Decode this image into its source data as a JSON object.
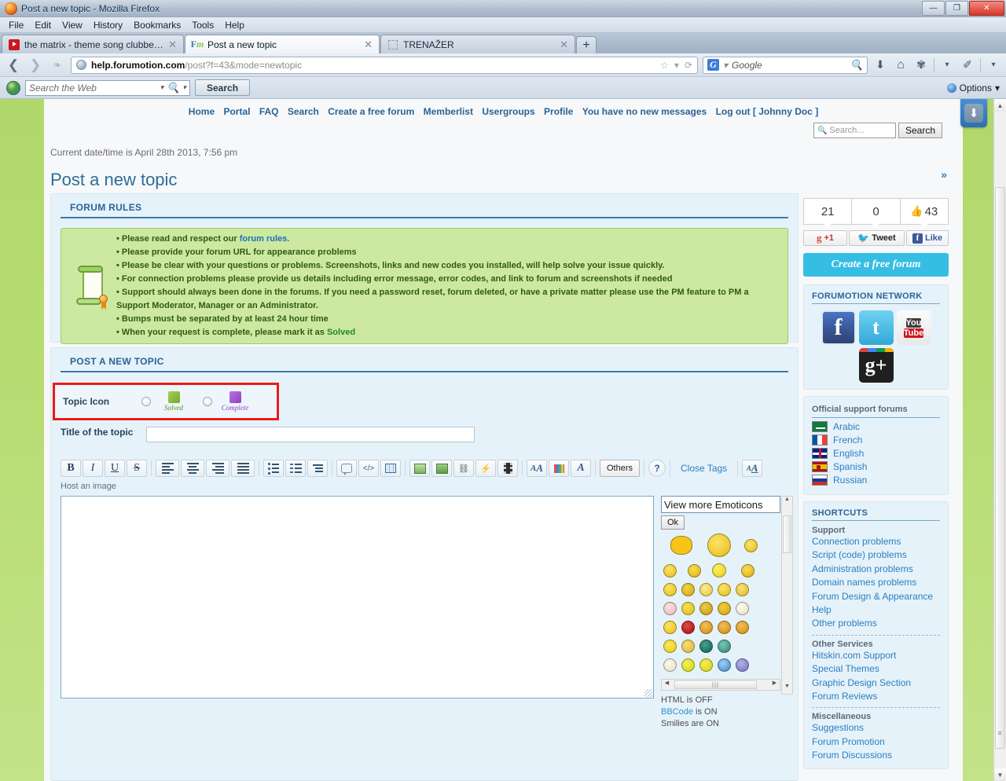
{
  "window": {
    "title": "Post a new topic - Mozilla Firefox",
    "minimize": "—",
    "maximize": "❐",
    "close": "✕"
  },
  "menubar": [
    {
      "label": "File"
    },
    {
      "label": "Edit"
    },
    {
      "label": "View"
    },
    {
      "label": "History"
    },
    {
      "label": "Bookmarks"
    },
    {
      "label": "Tools"
    },
    {
      "label": "Help"
    }
  ],
  "tabs": [
    {
      "label": "the matrix - theme song clubbed to d...",
      "close": "✕",
      "icon": "youtube-icon"
    },
    {
      "label": "Post a new topic",
      "close": "✕",
      "icon": "forumotion-icon"
    },
    {
      "label": "TRENAŽER",
      "close": "✕",
      "icon": "blank-favicon"
    }
  ],
  "newtab_label": "+",
  "navbar": {
    "back": "❮",
    "forward": "❯",
    "url_host": "help.forumotion.com",
    "url_path": "/post?f=43&mode=newtopic",
    "bookmark_icon": "☆",
    "dropdown_icon": "▾",
    "reload_icon": "⟳",
    "search_engine": "Google",
    "search_placeholder": "Google",
    "download_icon": "⬇",
    "home_icon": "⌂",
    "bookmarks_icon": "❧",
    "tools_icon": "✎"
  },
  "webbar": {
    "search_placeholder": "Search the Web",
    "search_button": "Search",
    "options_label": "Options",
    "options_caret": "▾"
  },
  "forum_nav": [
    "Home",
    "Portal",
    "FAQ",
    "Search",
    "Create a free forum",
    "Memberlist",
    "Usergroups",
    "Profile",
    "You have no new messages",
    "Log out [ Johnny Doc ]"
  ],
  "forum_search": {
    "placeholder": "Search...",
    "button": "Search"
  },
  "datetime": "Current date/time is April 28th 2013, 7:56 pm",
  "page_title": "Post a new topic",
  "forum_rules": {
    "heading": "FORUM RULES",
    "items": [
      {
        "pre": "Please read and respect our ",
        "link": "forum rules.",
        "post": ""
      },
      {
        "pre": "Please provide your forum URL for appearance problems",
        "link": "",
        "post": ""
      },
      {
        "pre": "Please be clear with your questions or problems. Screenshots, links and new codes you installed, will help solve your issue quickly.",
        "link": "",
        "post": ""
      },
      {
        "pre": "For connection problems please provide us details including error message, error codes, and link to forum and screenshots if needed",
        "link": "",
        "post": ""
      },
      {
        "pre": "Support should always been done in the forums. If you need a password reset, forum deleted, or have a private matter please use the PM feature to PM a Support Moderator, Manager or an Administrator.",
        "link": "",
        "post": ""
      },
      {
        "pre": "Bumps must be separated by at least 24 hour time",
        "link": "",
        "post": ""
      },
      {
        "pre": "When your request is complete, please mark it as ",
        "link": "",
        "post": "Solved"
      }
    ]
  },
  "post_form": {
    "heading": "POST A NEW TOPIC",
    "topic_icon_label": "Topic Icon",
    "topic_icons": [
      {
        "caption": "Solved",
        "color": "#76a92e"
      },
      {
        "caption": "Complete",
        "color": "#8e3fc4"
      }
    ],
    "title_label": "Title of the topic",
    "title_value": "",
    "host_image_label": "Host an image",
    "message_value": ""
  },
  "toolbar": {
    "bold": "B",
    "italic": "I",
    "underline": "U",
    "strike": "S",
    "others_label": "Others",
    "close_tags_label": "Close Tags",
    "help_icon": "?",
    "font_color_icon": "A",
    "font_size_icon": "A",
    "font_face_icon": "A"
  },
  "emoticons": {
    "more_label": "View more Emoticons",
    "ok_label": "Ok",
    "scroll_up": "▲",
    "scroll_down": "▼",
    "scroll_left": "◀",
    "scroll_right": "▶",
    "status": {
      "html": "HTML is OFF",
      "bbcode_name": "BBCode",
      "bbcode_state": " is ON",
      "smilies": "Smilies are ON"
    },
    "rows": [
      [
        {
          "name": "chef-smiley",
          "color": "#f5c518",
          "size": 26
        },
        {
          "name": "goofy-smiley",
          "color": "#f2cf2f",
          "size": 32
        },
        {
          "name": "grin-smiley",
          "color": "#f7d62e",
          "size": 18
        }
      ],
      [
        {
          "name": "smile-smiley",
          "color": "#f7d62e",
          "size": 18
        },
        {
          "name": "confused-smiley",
          "color": "#f2cf2f",
          "size": 18
        },
        {
          "name": "jumping-smiley",
          "color": "#f7e02e",
          "size": 20
        },
        {
          "name": "surprised-smiley",
          "color": "#f2cf2f",
          "size": 18
        }
      ],
      [
        {
          "name": "neutral-smiley",
          "color": "#f7d62e",
          "size": 18
        },
        {
          "name": "cool-smiley",
          "color": "#e8c728",
          "size": 18
        },
        {
          "name": "laugh-smiley",
          "color": "#f5de55",
          "size": 18
        },
        {
          "name": "wink-smiley",
          "color": "#f7d62e",
          "size": 18
        },
        {
          "name": "happy-smiley",
          "color": "#f3d84a",
          "size": 18
        }
      ],
      [
        {
          "name": "blush-smiley",
          "color": "#f2c7c7",
          "size": 18
        },
        {
          "name": "sick-smiley",
          "color": "#f0d330",
          "size": 18
        },
        {
          "name": "devil-smiley",
          "color": "#e0b51f",
          "size": 18
        },
        {
          "name": "angry-smiley",
          "color": "#e8c21c",
          "size": 18
        },
        {
          "name": "dizzy-smiley",
          "color": "#f7f1e0",
          "size": 18
        }
      ],
      [
        {
          "name": "wink2-smiley",
          "color": "#f7d62e",
          "size": 18
        },
        {
          "name": "red-ball-smiley",
          "color": "#cc1111",
          "size": 18
        },
        {
          "name": "exclamation-smiley",
          "color": "#e8a81c",
          "size": 18
        },
        {
          "name": "question-smiley",
          "color": "#e8a81c",
          "size": 18
        },
        {
          "name": "idea-smiley",
          "color": "#e8a81c",
          "size": 18
        }
      ],
      [
        {
          "name": "plain-smiley",
          "color": "#f2d41e",
          "size": 18
        },
        {
          "name": "glasses-smiley",
          "color": "#f0cf4a",
          "size": 18
        },
        {
          "name": "ninja-smiley",
          "color": "#1d6e63",
          "size": 18
        },
        {
          "name": "mask-smiley",
          "color": "#3e9a86",
          "size": 18
        }
      ],
      [
        {
          "name": "geek-smiley",
          "color": "#f5f0e0",
          "size": 18
        },
        {
          "name": "bigsmile-smiley",
          "color": "#e8e220",
          "size": 18
        },
        {
          "name": "shock-smiley",
          "color": "#e8e220",
          "size": 18
        },
        {
          "name": "blue-smiley",
          "color": "#5fa6e8",
          "size": 18
        },
        {
          "name": "purple-smiley",
          "color": "#8f8fd6",
          "size": 18
        }
      ]
    ]
  },
  "sidebar": {
    "chevrons": "»",
    "counters": [
      {
        "value": "21",
        "name": "gplus-count"
      },
      {
        "value": "0",
        "name": "tweet-count"
      },
      {
        "value": "43",
        "name": "like-count",
        "thumb": "👍"
      }
    ],
    "share_buttons": [
      {
        "label": "+1",
        "icon": "g",
        "name": "gplus-button"
      },
      {
        "label": "Tweet",
        "icon": "🐦",
        "name": "tweet-button"
      },
      {
        "label": "Like",
        "icon": "f",
        "name": "facebook-like-button"
      }
    ],
    "create_forum_label": "Create a free forum",
    "network": {
      "title": "FORUMOTION NETWORK",
      "icons": [
        {
          "name": "facebook-icon",
          "glyph": "f"
        },
        {
          "name": "twitter-icon",
          "glyph": "t"
        },
        {
          "name": "youtube-icon",
          "line1": "You",
          "line2": "Tube"
        },
        {
          "name": "googleplus-icon",
          "glyph": "g+"
        }
      ]
    },
    "support": {
      "title": "Official support forums",
      "languages": [
        {
          "label": "Arabic",
          "flag": "f-ar"
        },
        {
          "label": "French",
          "flag": "f-fr"
        },
        {
          "label": "English",
          "flag": "f-en"
        },
        {
          "label": "Spanish",
          "flag": "f-es"
        },
        {
          "label": "Russian",
          "flag": "f-ru"
        }
      ]
    },
    "shortcuts": {
      "title": "SHORTCUTS",
      "groups": [
        {
          "label": "Support",
          "links": [
            "Connection problems",
            "Script (code) problems",
            "Administration problems",
            "Domain names problems",
            "Forum Design & Appearance",
            "Help",
            "Other problems"
          ]
        },
        {
          "label": "Other Services",
          "links": [
            "Hitskin.com Support",
            "Special Themes",
            "Graphic Design Section",
            "Forum Reviews"
          ]
        },
        {
          "label": "Miscellaneous",
          "links": [
            "Suggestions",
            "Forum Promotion",
            "Forum Discussions"
          ]
        }
      ]
    }
  }
}
